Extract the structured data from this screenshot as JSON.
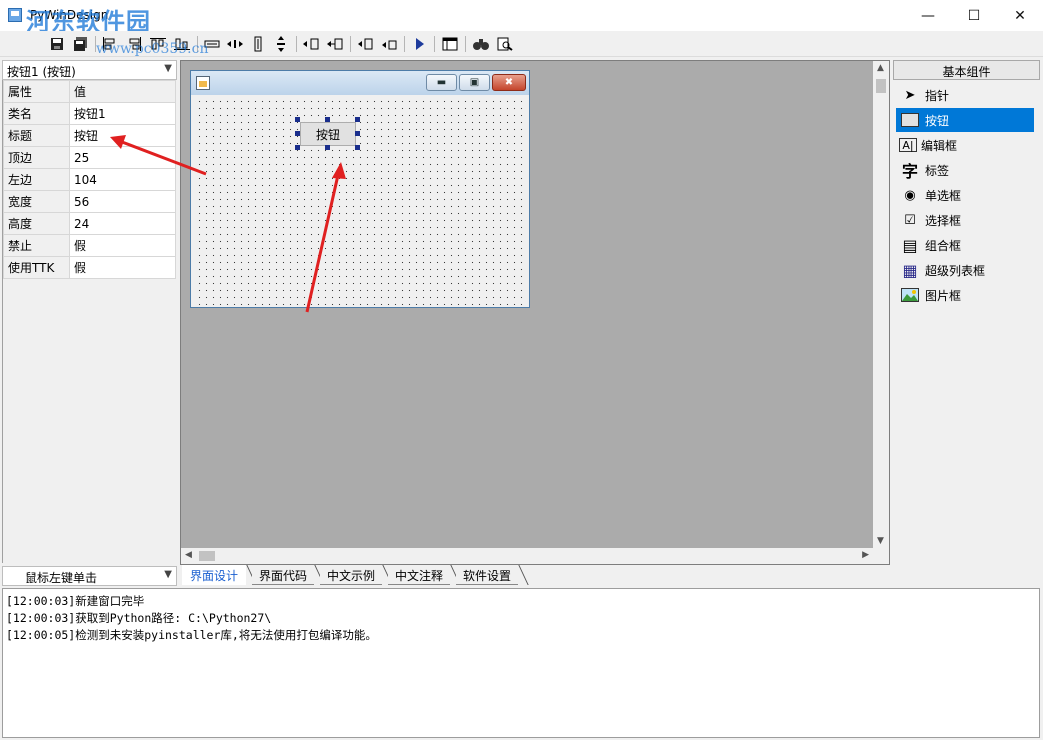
{
  "app": {
    "title": "PyWinDesign",
    "watermark_text": "河东软件园",
    "watermark_url": "www.pc0359.cn",
    "window_controls": {
      "minimize": "—",
      "maximize": "☐",
      "close": "✕"
    }
  },
  "toolbar": {
    "icons": [
      "save-icon",
      "save-all-icon",
      "align-left-icon",
      "align-right-icon",
      "align-top-icon",
      "align-bottom-icon",
      "same-width-icon",
      "h-spacing-icon",
      "same-height-icon",
      "v-spacing-icon",
      "move-left-icon",
      "move-right-icon",
      "move-up-icon",
      "move-down-icon",
      "run-icon",
      "form-layout-icon",
      "find-icon",
      "preview-icon"
    ]
  },
  "property_panel": {
    "selector": "按钮1 (按钮)",
    "header": {
      "key": "属性",
      "value": "值"
    },
    "rows": [
      {
        "key": "类名",
        "value": "按钮1"
      },
      {
        "key": "标题",
        "value": "按钮"
      },
      {
        "key": "顶边",
        "value": "25"
      },
      {
        "key": "左边",
        "value": "104"
      },
      {
        "key": "宽度",
        "value": "56"
      },
      {
        "key": "高度",
        "value": "24"
      },
      {
        "key": "禁止",
        "value": "假"
      },
      {
        "key": "使用TTK",
        "value": "假"
      }
    ]
  },
  "design_form": {
    "button_label": "按钮",
    "controls": {
      "minimize": "▬",
      "maximize": "▣",
      "close": "✖"
    }
  },
  "tabs": [
    {
      "label": "界面设计",
      "active": true
    },
    {
      "label": "界面代码",
      "active": false
    },
    {
      "label": "中文示例",
      "active": false
    },
    {
      "label": "中文注释",
      "active": false
    },
    {
      "label": "软件设置",
      "active": false
    }
  ],
  "components": {
    "header": "基本组件",
    "items": [
      {
        "label": "指针",
        "icon": "pointer-icon",
        "glyph": "➤"
      },
      {
        "label": "按钮",
        "icon": "button-icon",
        "glyph": ""
      },
      {
        "label": "编辑框",
        "icon": "edit-box-icon",
        "glyph": "A|"
      },
      {
        "label": "标签",
        "icon": "label-icon",
        "glyph": "字"
      },
      {
        "label": "单选框",
        "icon": "radio-icon",
        "glyph": "◉"
      },
      {
        "label": "选择框",
        "icon": "checkbox-icon",
        "glyph": "☑"
      },
      {
        "label": "组合框",
        "icon": "combo-box-icon",
        "glyph": "▤"
      },
      {
        "label": "超级列表框",
        "icon": "list-view-icon",
        "glyph": "▦"
      },
      {
        "label": "图片框",
        "icon": "picture-box-icon",
        "glyph": "▨"
      }
    ],
    "selected": "按钮"
  },
  "event_selector": "鼠标左键单击",
  "log": [
    "[12:00:03]新建窗口完毕",
    "[12:00:03]获取到Python路径: C:\\Python27\\",
    "[12:00:05]检测到未安装pyinstaller库,将无法使用打包编译功能。"
  ],
  "colors": {
    "accent": "#0078d7",
    "annotation_arrow": "#e02020",
    "selection_handle": "#1a2e8c"
  }
}
